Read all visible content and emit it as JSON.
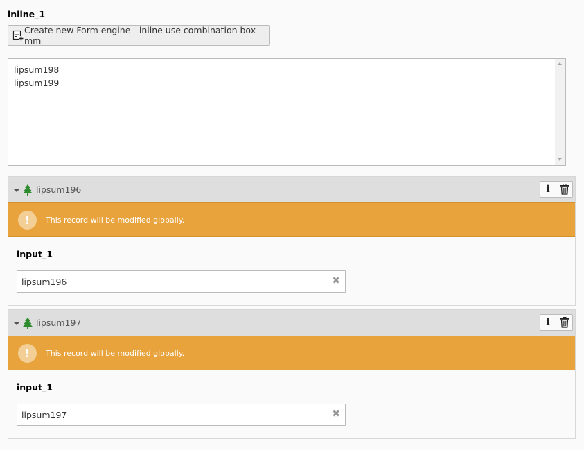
{
  "field": {
    "label": "inline_1",
    "create_button_label": "Create new Form engine - inline use combination box mm"
  },
  "selector": {
    "options": [
      "lipsum198",
      "lipsum199"
    ]
  },
  "records": [
    {
      "title": "lipsum196",
      "warning": "This record will be modified globally.",
      "input_label": "input_1",
      "input_value": "lipsum196"
    },
    {
      "title": "lipsum197",
      "warning": "This record will be modified globally.",
      "input_label": "input_1",
      "input_value": "lipsum197"
    }
  ],
  "icons": {
    "record": "tree-icon",
    "info": "info-icon",
    "delete": "trash-icon",
    "warning": "exclamation-icon",
    "create": "new-record-icon"
  },
  "colors": {
    "warning_bg": "#e8a33d",
    "tree_green": "#2e8b2e",
    "header_bg": "#dedede"
  }
}
